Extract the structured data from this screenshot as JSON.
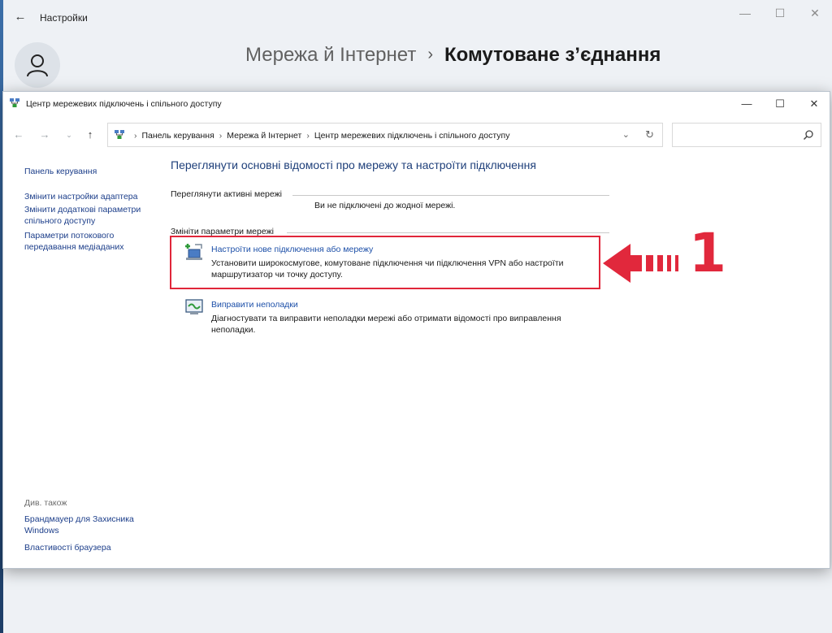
{
  "settings": {
    "title": "Настройки",
    "breadcrumb_parent": "Мережа й Інтернет",
    "breadcrumb_current": "Комутоване з’єднання"
  },
  "window": {
    "title": "Центр мережевих підключень і спільного доступу"
  },
  "address": {
    "crumbs": [
      "Панель керування",
      "Мережа й Інтернет",
      "Центр мережевих підключень і спільного доступу"
    ]
  },
  "sidebar": {
    "home": "Панель керування",
    "links": [
      "Змінити настройки адаптера",
      "Змінити додаткові параметри спільного доступу",
      "Параметри потокового передавання медіаданих"
    ],
    "see_also": "Див. також",
    "bottom_links": [
      "Брандмауер для Захисника Windows",
      "Властивості браузера"
    ]
  },
  "main": {
    "title": "Переглянути основні відомості про мережу та настроїти підключення",
    "active_networks": "Переглянути активні мережі",
    "no_networks": "Ви не підключені до жодної мережі.",
    "change_settings": "Змініти параметри мережі",
    "tasks": [
      {
        "link": "Настроїти нове підключення або мережу",
        "desc": "Установити широкосмугове, комутоване підключення чи підключення VPN або настроїти маршрутизатор чи точку доступу.",
        "icon": "new-connection-icon"
      },
      {
        "link": "Виправити неполадки",
        "desc": "Діагностувати та виправити неполадки мережі або отримати відомості про виправлення неполадки.",
        "icon": "troubleshoot-icon"
      }
    ]
  },
  "annotation": {
    "number": "1",
    "color": "#e1283c"
  }
}
